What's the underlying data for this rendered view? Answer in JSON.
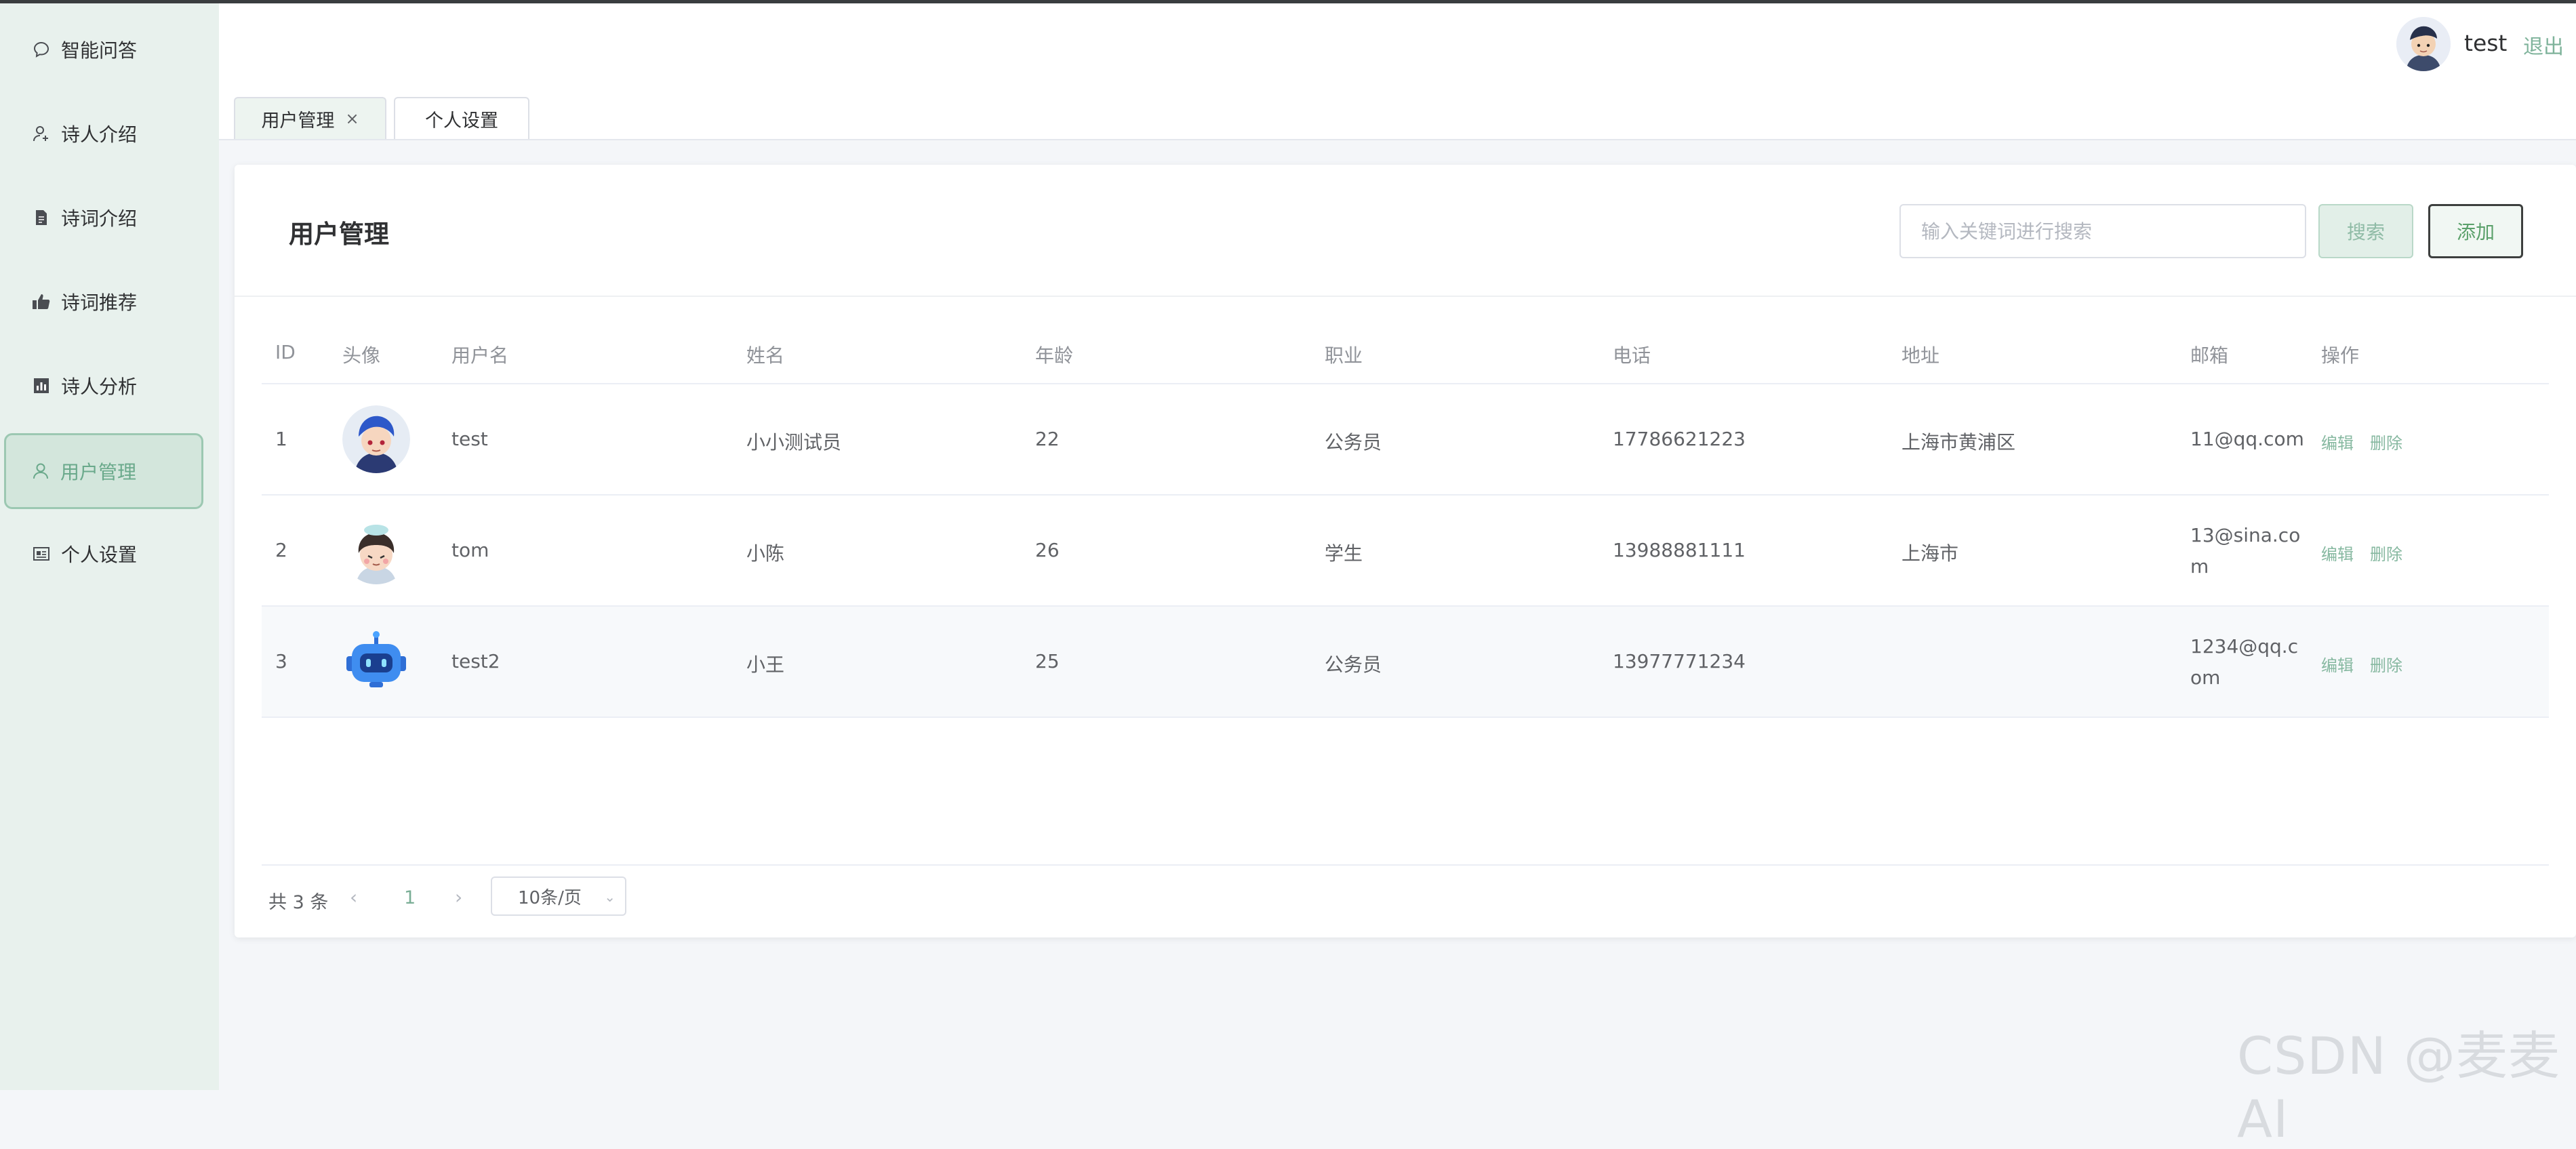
{
  "sidebar": {
    "items": [
      {
        "label": "智能问答",
        "icon": "chat-bubble-icon"
      },
      {
        "label": "诗人介绍",
        "icon": "user-plus-icon"
      },
      {
        "label": "诗词介绍",
        "icon": "document-icon"
      },
      {
        "label": "诗词推荐",
        "icon": "thumbs-up-icon"
      },
      {
        "label": "诗人分析",
        "icon": "bar-chart-icon"
      },
      {
        "label": "用户管理",
        "icon": "user-icon",
        "active": true
      },
      {
        "label": "个人设置",
        "icon": "id-card-icon"
      }
    ]
  },
  "header": {
    "username": "test",
    "logout": "退出"
  },
  "tabs": [
    {
      "label": "用户管理",
      "close": "×",
      "active": true
    },
    {
      "label": "个人设置"
    }
  ],
  "card": {
    "title": "用户管理",
    "search_placeholder": "输入关键词进行搜索",
    "search_label": "搜索",
    "add_label": "添加"
  },
  "table": {
    "headers": [
      "ID",
      "头像",
      "用户名",
      "姓名",
      "年龄",
      "职业",
      "电话",
      "地址",
      "邮箱",
      "操作"
    ],
    "rows": [
      {
        "id": "1",
        "username": "test",
        "name": "小小测试员",
        "age": "22",
        "job": "公务员",
        "phone": "17786621223",
        "address": "上海市黄浦区",
        "email": [
          "11@qq.com"
        ],
        "edit": "编辑",
        "delete": "删除"
      },
      {
        "id": "2",
        "username": "tom",
        "name": "小陈",
        "age": "26",
        "job": "学生",
        "phone": "13988881111",
        "address": "上海市",
        "email": [
          "13@sina.co",
          "m"
        ],
        "edit": "编辑",
        "delete": "删除"
      },
      {
        "id": "3",
        "username": "test2",
        "name": "小王",
        "age": "25",
        "job": "公务员",
        "phone": "13977771234",
        "address": "",
        "email": [
          "1234@qq.c",
          "om"
        ],
        "edit": "编辑",
        "delete": "删除"
      }
    ]
  },
  "pagination": {
    "total": "共 3 条",
    "prev": "‹",
    "page": "1",
    "next": "›",
    "page_size": "10条/页"
  },
  "watermark": "CSDN @麦麦AI",
  "colors": {
    "accent": "#7fb39b",
    "sidebar_bg": "#e8f1ed",
    "active_border": "#9cc8b2"
  }
}
